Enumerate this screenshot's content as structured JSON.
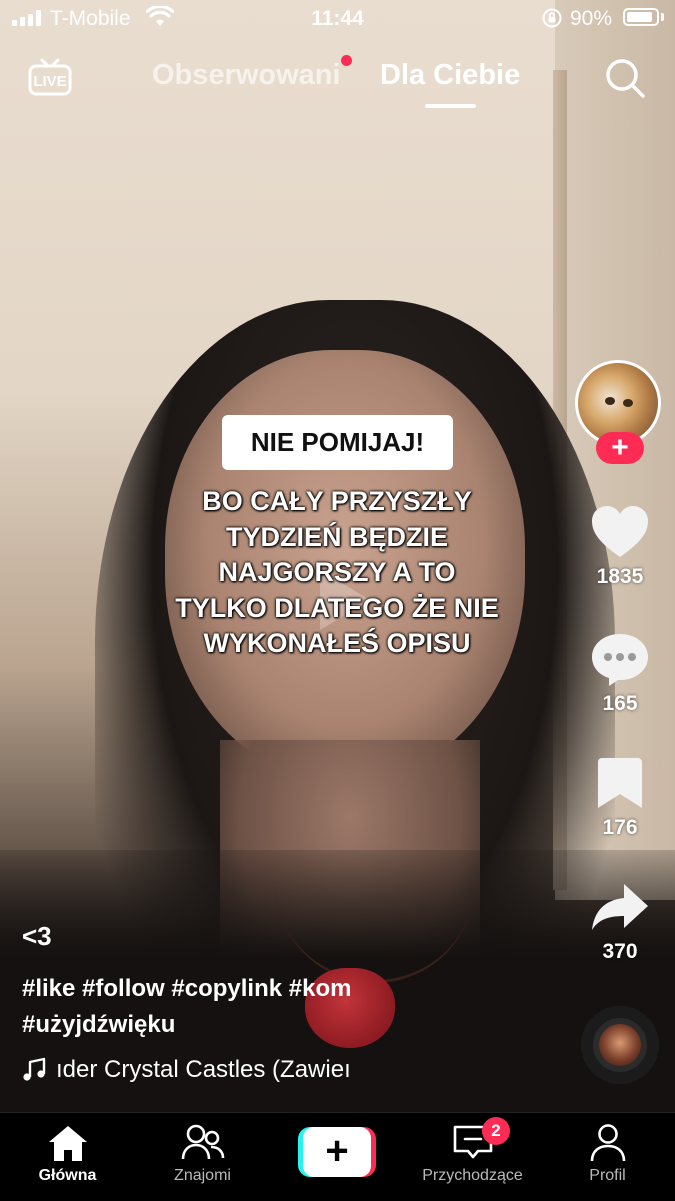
{
  "status_bar": {
    "carrier": "T-Mobile",
    "time": "11:44",
    "battery_percent": "90%",
    "battery_level": 0.9,
    "signal_bars": 4
  },
  "top_nav": {
    "live_label": "LIVE",
    "tab_following": "Obserwowani",
    "tab_for_you": "Dla Ciebie",
    "active_tab": "Dla Ciebie"
  },
  "video": {
    "caption_box": "NIE POMIJAJ!",
    "caption_lines": [
      "BO CAŁY PRZYSZŁY",
      "TYDZIEŃ BĘDZIE",
      "NAJGORSZY A TO",
      "TYLKO DLATEGO ŻE NIE",
      "WYKONAŁEŚ OPISU"
    ]
  },
  "actions": {
    "follow_symbol": "+",
    "likes": "1835",
    "comments": "165",
    "saves": "176",
    "shares": "370"
  },
  "description": {
    "title": "<3",
    "hashtags_line1": "#like #follow #copylink #kom",
    "hashtags_line2": "#użyjdźwięku",
    "music": "ıder Crystal Castles (Zawieı"
  },
  "bottom_nav": {
    "home": "Główna",
    "friends": "Znajomi",
    "create_symbol": "+",
    "inbox": "Przychodzące",
    "inbox_badge": "2",
    "profile": "Profil"
  },
  "colors": {
    "accent_red": "#fe2c55",
    "accent_cyan": "#25f4ee"
  }
}
